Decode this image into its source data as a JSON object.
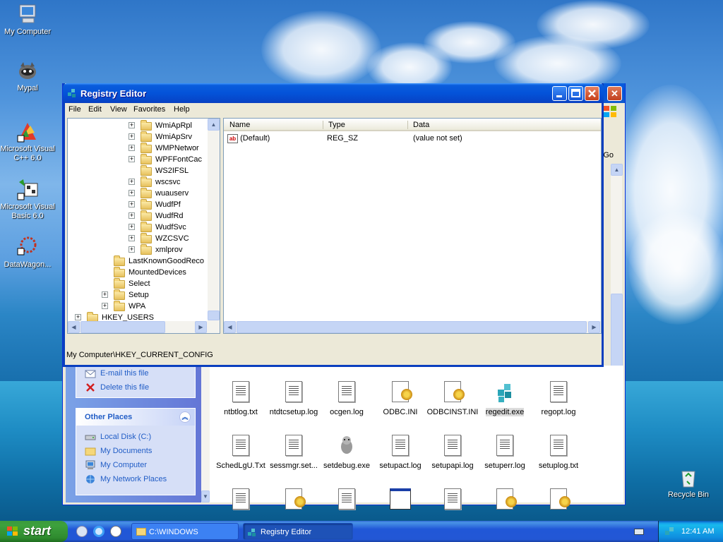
{
  "desktop": {
    "icons": [
      {
        "label": "My Computer",
        "icon": "my-computer-icon"
      },
      {
        "label": "Mypal",
        "icon": "mypal-icon"
      },
      {
        "label": "Microsoft Visual C++ 6.0",
        "icon": "visual-cpp-icon"
      },
      {
        "label": "Microsoft Visual Basic 6.0",
        "icon": "visual-basic-icon"
      },
      {
        "label": "DataWagon...",
        "icon": "datawagon-icon"
      },
      {
        "label": "Recycle Bin",
        "icon": "recycle-bin-icon"
      }
    ]
  },
  "explorer": {
    "go_label": "Go",
    "tasks": [
      {
        "label": "E-mail this file",
        "icon": "email-icon"
      },
      {
        "label": "Delete this file",
        "icon": "delete-icon"
      }
    ],
    "other_places": {
      "title": "Other Places",
      "links": [
        {
          "label": "Local Disk (C:)",
          "icon": "drive-icon"
        },
        {
          "label": "My Documents",
          "icon": "folder-icon"
        },
        {
          "label": "My Computer",
          "icon": "computer-icon"
        },
        {
          "label": "My Network Places",
          "icon": "network-icon"
        }
      ]
    },
    "files_row1": [
      {
        "name": "ntbtlog.txt",
        "type": "txt"
      },
      {
        "name": "ntdtcsetup.log",
        "type": "txt"
      },
      {
        "name": "ocgen.log",
        "type": "txt"
      },
      {
        "name": "ODBC.INI",
        "type": "ini"
      },
      {
        "name": "ODBCINST.INI",
        "type": "ini"
      },
      {
        "name": "regedit.exe",
        "type": "exe"
      },
      {
        "name": "regopt.log",
        "type": "txt"
      }
    ],
    "files_row2": [
      {
        "name": "SchedLgU.Txt",
        "type": "txt"
      },
      {
        "name": "sessmgr.set...",
        "type": "txt"
      },
      {
        "name": "setdebug.exe",
        "type": "exe"
      },
      {
        "name": "setupact.log",
        "type": "txt"
      },
      {
        "name": "setupapi.log",
        "type": "txt"
      },
      {
        "name": "setuperr.log",
        "type": "txt"
      },
      {
        "name": "setuplog.txt",
        "type": "txt"
      }
    ]
  },
  "registry": {
    "title": "Registry Editor",
    "menu": [
      "File",
      "Edit",
      "View",
      "Favorites",
      "Help"
    ],
    "tree": [
      {
        "label": "WmiApRpl",
        "level": 3,
        "expander": true
      },
      {
        "label": "WmiApSrv",
        "level": 3,
        "expander": true
      },
      {
        "label": "WMPNetwor",
        "level": 3,
        "expander": true
      },
      {
        "label": "WPFFontCac",
        "level": 3,
        "expander": true
      },
      {
        "label": "WS2IFSL",
        "level": 3,
        "expander": false
      },
      {
        "label": "wscsvc",
        "level": 3,
        "expander": true
      },
      {
        "label": "wuauserv",
        "level": 3,
        "expander": true
      },
      {
        "label": "WudfPf",
        "level": 3,
        "expander": true
      },
      {
        "label": "WudfRd",
        "level": 3,
        "expander": true
      },
      {
        "label": "WudfSvc",
        "level": 3,
        "expander": true
      },
      {
        "label": "WZCSVC",
        "level": 3,
        "expander": true
      },
      {
        "label": "xmlprov",
        "level": 3,
        "expander": true
      },
      {
        "label": "LastKnownGoodReco",
        "level": 2,
        "expander": false
      },
      {
        "label": "MountedDevices",
        "level": 2,
        "expander": false
      },
      {
        "label": "Select",
        "level": 2,
        "expander": false
      },
      {
        "label": "Setup",
        "level": 2,
        "expander": true
      },
      {
        "label": "WPA",
        "level": 2,
        "expander": true
      },
      {
        "label": "HKEY_USERS",
        "level": 0,
        "expander": true
      },
      {
        "label": "HKEY_CURRENT_CONFIG",
        "level": 0,
        "expander": true,
        "selected": true
      }
    ],
    "columns": {
      "name": "Name",
      "type": "Type",
      "data": "Data"
    },
    "values": [
      {
        "name": "(Default)",
        "type": "REG_SZ",
        "data": "(value not set)"
      }
    ],
    "status": "My Computer\\HKEY_CURRENT_CONFIG"
  },
  "taskbar": {
    "start_label": "start",
    "tasks": [
      {
        "label": "C:\\WINDOWS",
        "icon": "folder-icon"
      },
      {
        "label": "Registry Editor",
        "icon": "regedit-icon"
      }
    ],
    "clock": "12:41 AM"
  }
}
